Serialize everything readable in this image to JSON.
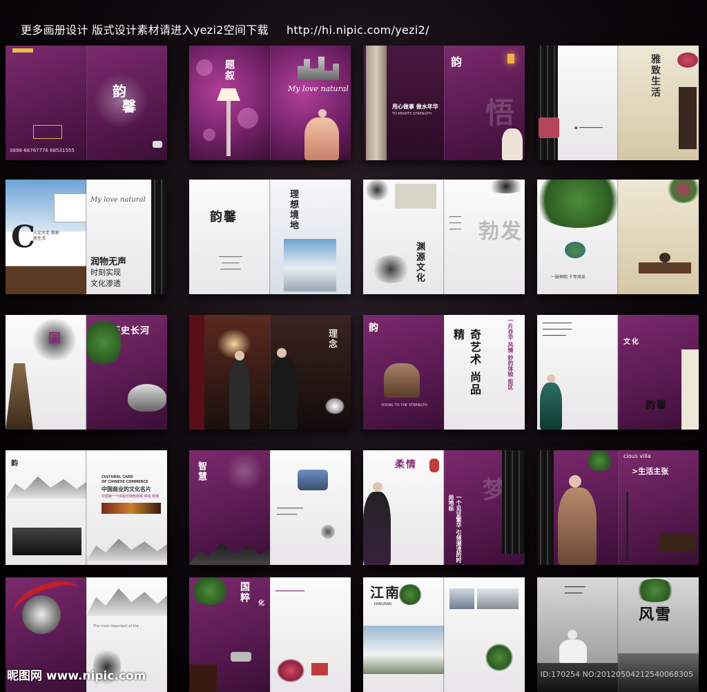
{
  "header": {
    "title": "更多画册设计 版式设计素材请进入yezi2空间下载",
    "url": "http://hi.nipic.com/yezi2/"
  },
  "spreads": {
    "s1": {
      "calli": "韵",
      "calli2": "馨",
      "phone": "0898-68767776  68531555"
    },
    "s2": {
      "calli": "题叙",
      "script": "My love natural"
    },
    "s3": {
      "slogan": "用心做事 做水年华",
      "slogan_en": "TO HEARTS STRENGTH",
      "calli": "韵",
      "big": "悟"
    },
    "s4": {
      "calli": "雅致生活"
    },
    "s5": {
      "script": "My love natural",
      "l1": "润物无声",
      "l2": "时刻实现",
      "l3": "文化渗透",
      "card": "人文大宅 栽家居生活"
    },
    "s6": {
      "calli": "韵馨",
      "calli2": "理想境地"
    },
    "s7": {
      "calli": "渊源文化",
      "big": "勃发"
    },
    "s8": {
      "small": "一脉神韵 千年风采"
    },
    "s9": {
      "title": "历史长河",
      "calli": "国"
    },
    "s10": {
      "calli": "理念"
    },
    "s11": {
      "calli": "韵",
      "big": "奇艺术 尚品 精",
      "side": "一片亦华 风情 妙的体验 街区",
      "en": "YOUNG TO THE STRENGTH"
    },
    "s12": {
      "calli": "韵馨",
      "calli2": "文化"
    },
    "s13": {
      "en1": "CULTURAL CARD",
      "en2": "OF CHINESE COMMERCE",
      "title": "中国商业的文化名片",
      "sub": "中国第一个体验式特色商城 缔造 经典",
      "calli": "韵"
    },
    "s14": {
      "calli": "智慧"
    },
    "s15": {
      "calli": "柔情",
      "big": "梦",
      "side": "一个见证繁华 引领潮流的时尚地标"
    },
    "s16": {
      "en": "cious villa",
      "title": ">生活主张"
    },
    "s17": {
      "note": "The most important of the..."
    },
    "s18": {
      "calli": "国粹",
      "calli2": "化"
    },
    "s19": {
      "calli": "江南",
      "en": "JIANGNAN"
    },
    "s20": {
      "calli": "风雪"
    }
  },
  "footer": {
    "watermark": "昵图网 www.nipic.com",
    "id_line": "ID:170254 NO:20120504212540068305"
  }
}
